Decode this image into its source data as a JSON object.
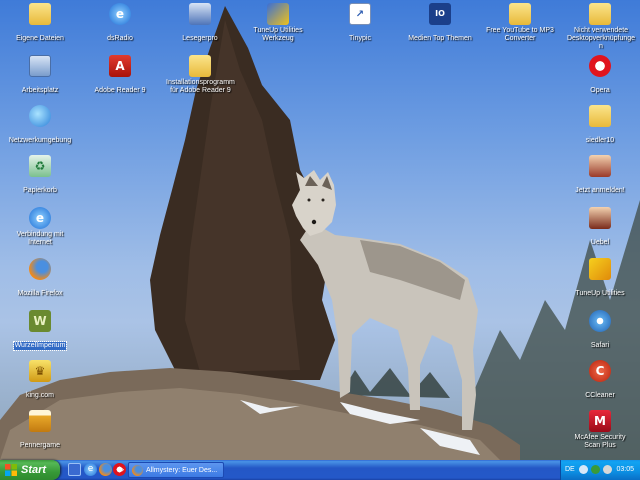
{
  "desktop": {
    "icons": [
      {
        "label": "Eigene Dateien",
        "icon": "folder-icon"
      },
      {
        "label": "Arbeitsplatz",
        "icon": "computer-icon"
      },
      {
        "label": "Netzwerkumgebung",
        "icon": "network-icon"
      },
      {
        "label": "Papierkorb",
        "icon": "recycle-bin-icon"
      },
      {
        "label": "Verbindung mit Internet",
        "icon": "internet-explorer-icon"
      },
      {
        "label": "Mozilla Firefox",
        "icon": "firefox-icon"
      },
      {
        "label": "WurzelImperium",
        "icon": "game-icon"
      },
      {
        "label": "king.com",
        "icon": "crown-icon"
      },
      {
        "label": "Pennergame",
        "icon": "beer-icon"
      },
      {
        "label": "dsRadio",
        "icon": "internet-explorer-icon"
      },
      {
        "label": "Adobe Reader 9",
        "icon": "pdf-icon"
      },
      {
        "label": "Installationsprogramm für Adobe Reader 9",
        "icon": "folder-icon"
      },
      {
        "label": "Lesegerpro",
        "icon": "computer-icon"
      },
      {
        "label": "TuneUp Utilities Werkzeug",
        "icon": "tuneup-icon"
      },
      {
        "label": "Tinypic",
        "icon": "shortcut-icon"
      },
      {
        "label": "Medien Top Themen",
        "icon": "io-icon"
      },
      {
        "label": "Free YouTube to MP3 Converter",
        "icon": "folder-icon"
      },
      {
        "label": "Nicht verwendete Desktopverknüpfungen",
        "icon": "folder-icon"
      },
      {
        "label": "Opera",
        "icon": "opera-icon"
      },
      {
        "label": "siedler10",
        "icon": "folder-icon"
      },
      {
        "label": "Jetzt anmelden!",
        "icon": "game-figure-icon"
      },
      {
        "label": "Uebel",
        "icon": "game-figure-icon"
      },
      {
        "label": "TuneUp Utilities",
        "icon": "tuneup-icon"
      },
      {
        "label": "Safari",
        "icon": "safari-icon"
      },
      {
        "label": "CCleaner",
        "icon": "ccleaner-icon"
      },
      {
        "label": "McAfee Security Scan Plus",
        "icon": "mcafee-icon"
      }
    ]
  },
  "taskbar": {
    "start_label": "Start",
    "quicklaunch": [
      {
        "icon": "show-desktop-icon"
      },
      {
        "icon": "internet-explorer-icon"
      },
      {
        "icon": "firefox-icon"
      },
      {
        "icon": "opera-icon"
      },
      {
        "icon": "expand-chevron-icon"
      }
    ],
    "active_task": "Allmystery: Euer Des...",
    "tray": {
      "language": "DE",
      "icons": [
        "network-tray-icon",
        "security-tray-icon",
        "volume-tray-icon"
      ],
      "clock": "03:05"
    }
  },
  "colors": {
    "taskbar_blue": "#2458c8",
    "start_green": "#379937",
    "tray_blue": "#0c8ee2",
    "selection_blue": "#316ac5"
  }
}
